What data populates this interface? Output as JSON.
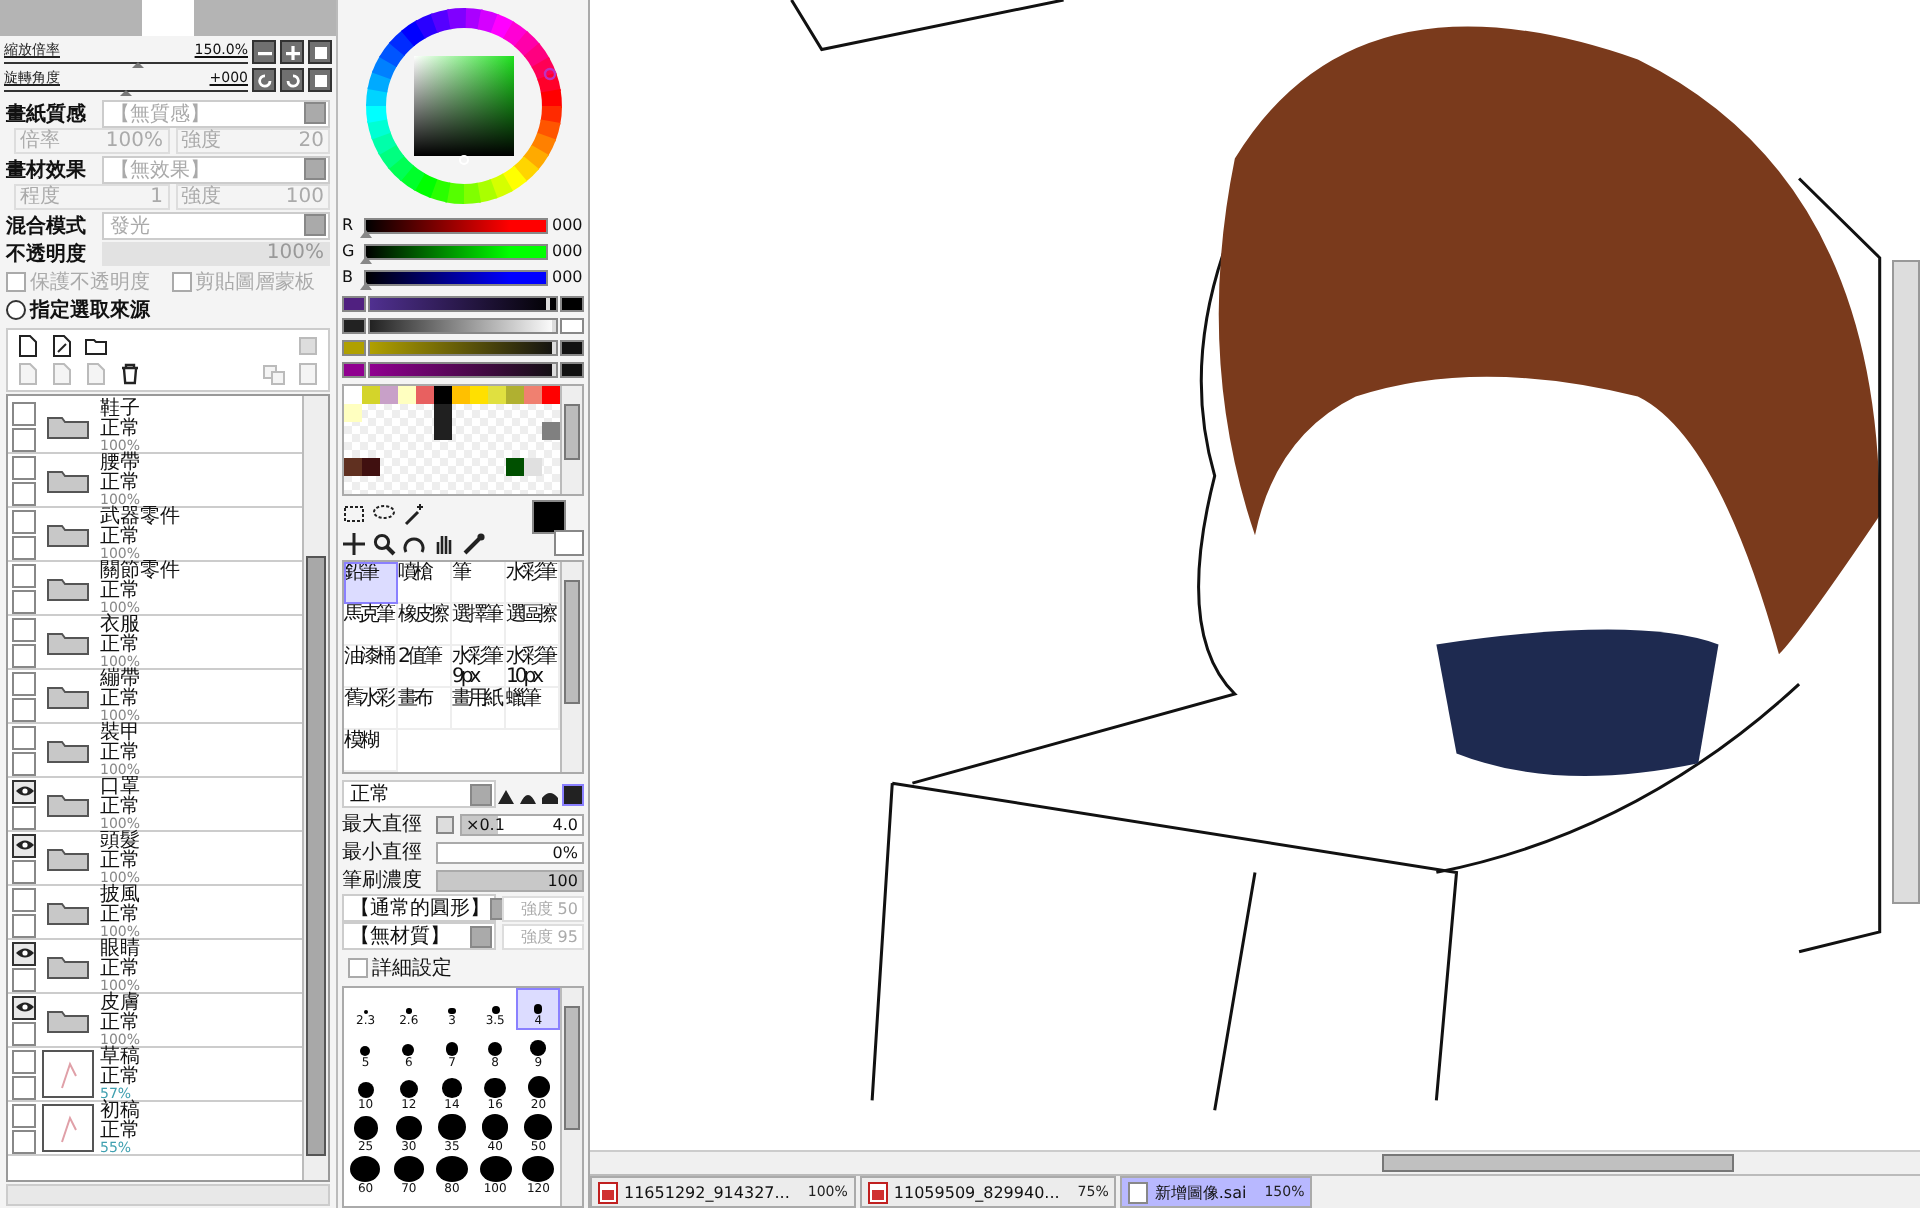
{
  "navigator": {
    "zoom_label": "縮放倍率",
    "zoom_value": "150.0%",
    "zoom_level": {
      "level": 0.55
    },
    "rotate_label": "旋轉角度",
    "rotate_value": "+000",
    "rotate_level": {
      "level": 0.5
    }
  },
  "layer_properties": {
    "paper_label": "畫紙質感",
    "paper_value": "【無質感】",
    "paper_scale_label": "倍率",
    "paper_scale": "100%",
    "paper_strength_label": "強度",
    "paper_strength": "20",
    "effect_label": "畫材效果",
    "effect_value": "【無效果】",
    "effect_amount_label": "程度",
    "effect_amount": "1",
    "effect_strength_label": "強度",
    "effect_strength": "100",
    "blend_label": "混合模式",
    "blend_value": "發光",
    "opacity_label": "不透明度",
    "opacity_value": "100%",
    "opacity": {
      "level": 1
    },
    "protect_label": "保護不透明度",
    "protect_checked": false,
    "clip_label": "剪貼圖層蒙板",
    "clip_checked": false,
    "source_label": "指定選取來源",
    "source_selected": false
  },
  "layers": [
    {
      "kind": "folder",
      "name": "鞋子",
      "mode": "正常",
      "opacity": "100%",
      "visible": false
    },
    {
      "kind": "folder",
      "name": "腰帶",
      "mode": "正常",
      "opacity": "100%",
      "visible": false
    },
    {
      "kind": "folder",
      "name": "武器零件",
      "mode": "正常",
      "opacity": "100%",
      "visible": false
    },
    {
      "kind": "folder",
      "name": "關節零件",
      "mode": "正常",
      "opacity": "100%",
      "visible": false
    },
    {
      "kind": "folder",
      "name": "衣服",
      "mode": "正常",
      "opacity": "100%",
      "visible": false
    },
    {
      "kind": "folder",
      "name": "繃帶",
      "mode": "正常",
      "opacity": "100%",
      "visible": false
    },
    {
      "kind": "folder",
      "name": "裝甲",
      "mode": "正常",
      "opacity": "100%",
      "visible": false
    },
    {
      "kind": "folder",
      "name": "口罩",
      "mode": "正常",
      "opacity": "100%",
      "visible": true
    },
    {
      "kind": "folder",
      "name": "頭髮",
      "mode": "正常",
      "opacity": "100%",
      "visible": true
    },
    {
      "kind": "folder",
      "name": "披風",
      "mode": "正常",
      "opacity": "100%",
      "visible": false
    },
    {
      "kind": "folder",
      "name": "眼睛",
      "mode": "正常",
      "opacity": "100%",
      "visible": true
    },
    {
      "kind": "folder",
      "name": "皮膚",
      "mode": "正常",
      "opacity": "100%",
      "visible": true
    },
    {
      "kind": "layer",
      "name": "草稿",
      "mode": "正常",
      "opacity": "57%",
      "visible": false
    },
    {
      "kind": "layer",
      "name": "初稿",
      "mode": "正常",
      "opacity": "55%",
      "visible": false
    }
  ],
  "color_panel": {
    "rgb": [
      {
        "label": "R",
        "value": "000",
        "level": 0,
        "color": "#ff0000"
      },
      {
        "label": "G",
        "value": "000",
        "level": 0,
        "color": "#00ff00"
      },
      {
        "label": "B",
        "value": "000",
        "level": 0,
        "color": "#0000ff"
      }
    ],
    "swatch_rows": [
      [
        {
          "color": "#ffffff"
        },
        {
          "color": "#d4d42a"
        },
        {
          "color": "#c8a0c8"
        },
        {
          "color": "#ffffc0"
        },
        {
          "color": "#e86060"
        },
        {
          "color": "#000000"
        },
        {
          "color": "#ffc000"
        },
        {
          "color": "#ffe000"
        },
        {
          "color": "#e0e040"
        },
        {
          "color": "#b0b030"
        },
        {
          "color": "#f08070"
        },
        {
          "color": "#ff0000"
        }
      ],
      [
        {
          "color": "#ffffc0"
        },
        null,
        null,
        null,
        null,
        {
          "color": "#202020"
        },
        null,
        null,
        null,
        null,
        null,
        null
      ],
      [
        null,
        null,
        null,
        null,
        null,
        {
          "color": "#202020"
        },
        null,
        null,
        null,
        null,
        null,
        {
          "color": "#808080"
        }
      ],
      [
        null,
        null,
        null,
        null,
        null,
        null,
        null,
        null,
        null,
        null,
        null,
        null
      ],
      [
        {
          "color": "#603020"
        },
        {
          "color": "#401010"
        },
        null,
        null,
        null,
        null,
        null,
        null,
        null,
        {
          "color": "#005000"
        },
        {
          "color": "#e0e0e0"
        },
        null
      ],
      [
        null,
        null,
        null,
        null,
        null,
        null,
        null,
        null,
        null,
        null,
        null,
        null
      ]
    ],
    "mix_sliders": [
      {
        "level": 0.97
      },
      {
        "level": 1
      },
      {
        "level": 1
      },
      {
        "level": 1
      }
    ]
  },
  "brush_tools": [
    {
      "label": "鉛筆",
      "selected": true
    },
    {
      "label": "噴槍",
      "selected": false
    },
    {
      "label": "筆",
      "selected": false
    },
    {
      "label": "水彩筆",
      "selected": false
    },
    {
      "label": "馬克筆",
      "selected": false
    },
    {
      "label": "橡皮擦",
      "selected": false
    },
    {
      "label": "選擇筆",
      "selected": false
    },
    {
      "label": "選區擦",
      "selected": false
    },
    {
      "label": "油漆桶",
      "selected": false
    },
    {
      "label": "2值筆",
      "selected": false
    },
    {
      "label": "水彩筆9px",
      "selected": false
    },
    {
      "label": "水彩筆10px",
      "selected": false
    },
    {
      "label": "舊水彩",
      "selected": false
    },
    {
      "label": "畫布",
      "selected": false
    },
    {
      "label": "畫用紙",
      "selected": false
    },
    {
      "label": "蠟筆",
      "selected": false
    },
    {
      "label": "模糊",
      "selected": false
    }
  ],
  "brush_settings": {
    "mode": "正常",
    "max_size": {
      "label": "最大直徑",
      "multiplier": "×0.1",
      "value": "4.0",
      "level": 0.3
    },
    "min_size": {
      "label": "最小直徑",
      "value": "0%",
      "level": 0
    },
    "density": {
      "label": "筆刷濃度",
      "value": "100",
      "level": 1
    },
    "shape": "【通常的圓形】",
    "shape_strength": "強度 50",
    "texture": "【無材質】",
    "texture_strength": "強度 95",
    "detail_label": "詳細設定",
    "detail_checked": false
  },
  "brush_sizes": [
    {
      "label": "2.3",
      "selected": false
    },
    {
      "label": "2.6",
      "selected": false
    },
    {
      "label": "3",
      "selected": false
    },
    {
      "label": "3.5",
      "selected": false
    },
    {
      "label": "4",
      "selected": true
    },
    {
      "label": "5",
      "selected": false
    },
    {
      "label": "6",
      "selected": false
    },
    {
      "label": "7",
      "selected": false
    },
    {
      "label": "8",
      "selected": false
    },
    {
      "label": "9",
      "selected": false
    },
    {
      "label": "10",
      "selected": false
    },
    {
      "label": "12",
      "selected": false
    },
    {
      "label": "14",
      "selected": false
    },
    {
      "label": "16",
      "selected": false
    },
    {
      "label": "20",
      "selected": false
    },
    {
      "label": "25",
      "selected": false
    },
    {
      "label": "30",
      "selected": false
    },
    {
      "label": "35",
      "selected": false
    },
    {
      "label": "40",
      "selected": false
    },
    {
      "label": "50",
      "selected": false
    },
    {
      "label": "60",
      "selected": false
    },
    {
      "label": "70",
      "selected": false
    },
    {
      "label": "80",
      "selected": false
    },
    {
      "label": "100",
      "selected": false
    },
    {
      "label": "120",
      "selected": false
    }
  ],
  "document_tabs": [
    {
      "name": "11651292_914327...",
      "zoom": "100%",
      "selected": false
    },
    {
      "name": "11059509_829940...",
      "zoom": "75%",
      "selected": false
    },
    {
      "name": "新增圖像.sai",
      "zoom": "150%",
      "selected": true
    }
  ]
}
